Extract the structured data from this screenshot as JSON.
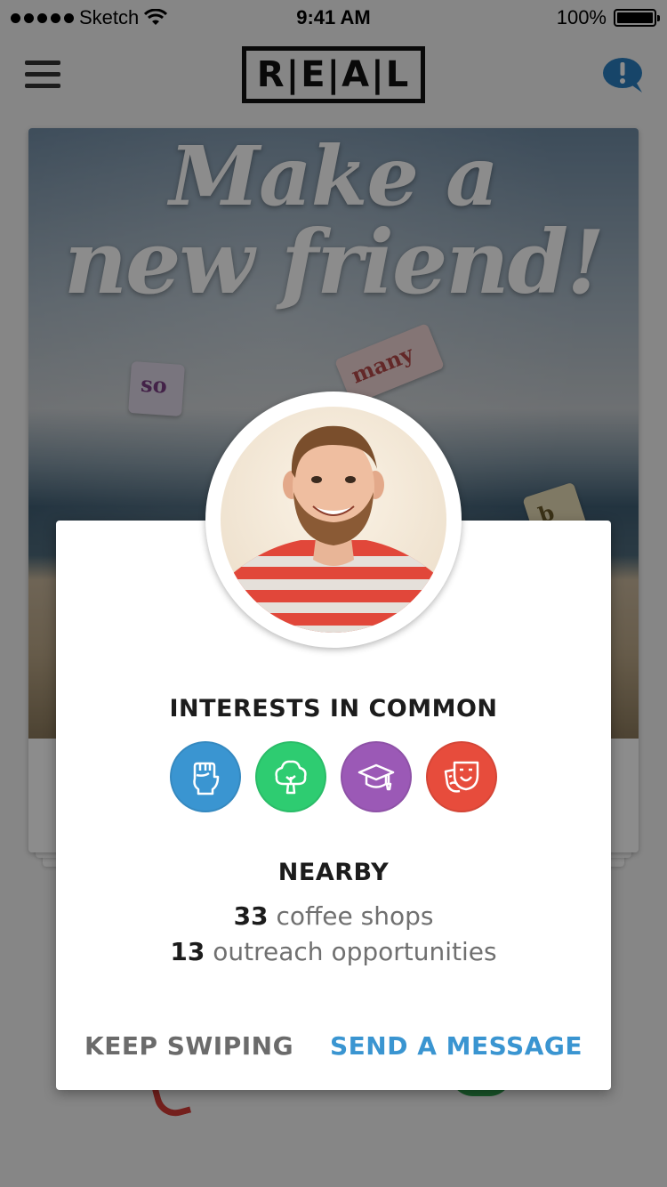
{
  "status_bar": {
    "carrier": "Sketch",
    "time": "9:41 AM",
    "battery": "100%"
  },
  "nav": {
    "logo": "R|E|A|L",
    "menu_icon": "hamburger-menu-icon",
    "help_icon": "speech-bubble-exclamation-icon"
  },
  "card": {
    "headline_line1": "Make a",
    "headline_line2": "new friend!",
    "word_tiles": [
      "so",
      "many",
      "b"
    ]
  },
  "modal": {
    "interests_title": "INTERESTS IN COMMON",
    "interests": [
      {
        "name": "fist-icon",
        "color": "#3a95d1"
      },
      {
        "name": "tree-icon",
        "color": "#2ecc71"
      },
      {
        "name": "graduation-cap-icon",
        "color": "#9b59b6"
      },
      {
        "name": "theater-masks-icon",
        "color": "#e74c3c"
      }
    ],
    "nearby_title": "NEARBY",
    "nearby": [
      {
        "count": "33",
        "label": "coffee shops"
      },
      {
        "count": "13",
        "label": "outreach opportunities"
      }
    ],
    "keep_swiping_label": "KEEP SWIPING",
    "send_message_label": "SEND A MESSAGE"
  },
  "colors": {
    "accent": "#3a95d1",
    "secondary_text": "#6b6b6b"
  }
}
